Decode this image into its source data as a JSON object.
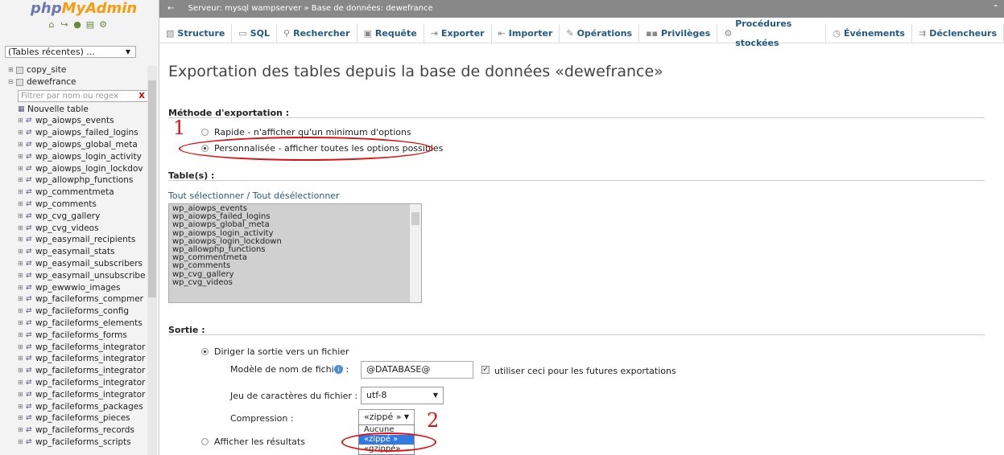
{
  "nav": {
    "logo_php": "php",
    "logo_my": "MyAdmin",
    "logo_icons": [
      "home-icon",
      "exit-icon",
      "help-icon",
      "docs-icon",
      "settings-icon"
    ],
    "recent_label": "(Tables récentes) ...",
    "filter_placeholder": "Filtrer par nom ou regex",
    "filter_clear": "X",
    "databases": [
      "copy_site",
      "dewefrance"
    ],
    "new_table": "Nouvelle table",
    "tables": [
      "wp_aiowps_events",
      "wp_aiowps_failed_logins",
      "wp_aiowps_global_meta",
      "wp_aiowps_login_activity",
      "wp_aiowps_login_lockdov",
      "wp_allowphp_functions",
      "wp_commentmeta",
      "wp_comments",
      "wp_cvg_gallery",
      "wp_cvg_videos",
      "wp_easymail_recipients",
      "wp_easymail_stats",
      "wp_easymail_subscribers",
      "wp_easymail_unsubscribe",
      "wp_ewwwio_images",
      "wp_facileforms_compmer",
      "wp_facileforms_config",
      "wp_facileforms_elements",
      "wp_facileforms_forms",
      "wp_facileforms_integrator",
      "wp_facileforms_integrator",
      "wp_facileforms_integrator",
      "wp_facileforms_integrator",
      "wp_facileforms_integrator",
      "wp_facileforms_packages",
      "wp_facileforms_pieces",
      "wp_facileforms_records",
      "wp_facileforms_scripts"
    ]
  },
  "topbar": {
    "back": "←",
    "breadcrumb": "Serveur: mysql wampserver » Base de données: dewefrance",
    "close": "⌃"
  },
  "tabs": [
    {
      "label": "Structure",
      "icon": "structure-icon"
    },
    {
      "label": "SQL",
      "icon": "sql-icon"
    },
    {
      "label": "Rechercher",
      "icon": "search-icon"
    },
    {
      "label": "Requête",
      "icon": "query-icon"
    },
    {
      "label": "Exporter",
      "icon": "export-icon"
    },
    {
      "label": "Importer",
      "icon": "import-icon"
    },
    {
      "label": "Opérations",
      "icon": "wrench-icon"
    },
    {
      "label": "Privilèges",
      "icon": "privileges-icon"
    },
    {
      "label": "Procédures stockées",
      "icon": "procedures-icon"
    },
    {
      "label": "Événements",
      "icon": "clock-icon"
    },
    {
      "label": "Déclencheurs",
      "icon": "trigger-icon"
    }
  ],
  "main": {
    "title": "Exportation des tables depuis la base de données «dewefrance»",
    "method_label": "Méthode d'exportation :",
    "method_quick": "Rapide - n'afficher qu'un minimum d'options",
    "method_custom": "Personnalisée - afficher toutes les options possibles",
    "tables_label": "Table(s) :",
    "select_all": "Tout sélectionner / Tout désélectionner",
    "table_list": [
      "wp_aiowps_events",
      "wp_aiowps_failed_logins",
      "wp_aiowps_global_meta",
      "wp_aiowps_login_activity",
      "wp_aiowps_login_lockdown",
      "wp_allowphp_functions",
      "wp_commentmeta",
      "wp_comments",
      "wp_cvg_gallery",
      "wp_cvg_videos"
    ],
    "output_label": "Sortie :",
    "output_to_file": "Diriger la sortie vers un fichier",
    "filename_label": "Modèle de nom de fichier :",
    "filename_value": "@DATABASE@",
    "remember_label": "utiliser ceci pour les futures exportations",
    "charset_label": "Jeu de caractères du fichier :",
    "charset_value": "utf-8",
    "compression_label": "Compression :",
    "compression_value": "«zippé »",
    "compression_options": [
      "Aucune",
      "«zippé »",
      "«gzippé»"
    ],
    "show_results": "Afficher les résultats"
  },
  "annotations": {
    "mark1": "1",
    "mark2": "2",
    "color": "#dd1111"
  }
}
